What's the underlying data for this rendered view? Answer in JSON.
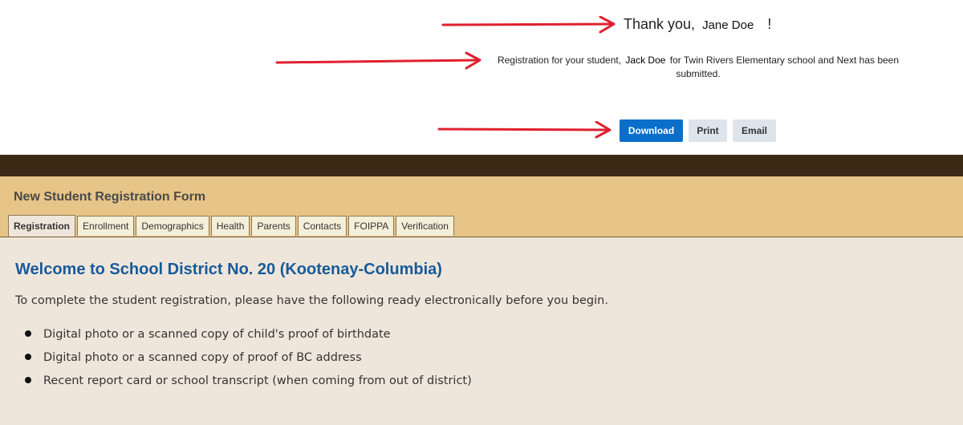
{
  "confirmation": {
    "thanks_prefix": "Thank you,",
    "parent_name": "Jane Doe",
    "thanks_suffix": "!",
    "registration_prefix": "Registration for your student,",
    "student_name": "Jack Doe",
    "registration_suffix": "for Twin Rivers Elementary school and Next has been submitted."
  },
  "actions": {
    "download_label": "Download",
    "print_label": "Print",
    "email_label": "Email"
  },
  "colors": {
    "accent_arrow": "#e0202e",
    "primary_button": "#0b6fc9",
    "header_dark": "#3b2914",
    "header_tan": "#e7c487",
    "content_bg": "#efe6db",
    "heading_blue": "#175a9b"
  },
  "form": {
    "title": "New Student Registration Form",
    "tabs": [
      {
        "label": "Registration",
        "active": true
      },
      {
        "label": "Enrollment",
        "active": false
      },
      {
        "label": "Demographics",
        "active": false
      },
      {
        "label": "Health",
        "active": false
      },
      {
        "label": "Parents",
        "active": false
      },
      {
        "label": "Contacts",
        "active": false
      },
      {
        "label": "FOIPPA",
        "active": false
      },
      {
        "label": "Verification",
        "active": false
      }
    ]
  },
  "main": {
    "heading": "Welcome to School District No. 20 (Kootenay-Columbia)",
    "intro": "To complete the student registration, please have the following ready electronically before you begin.",
    "requirements": [
      "Digital photo or a scanned copy of child's proof of birthdate",
      "Digital photo or a scanned copy of proof of BC address",
      "Recent report card or school transcript (when coming from out of district)"
    ]
  }
}
